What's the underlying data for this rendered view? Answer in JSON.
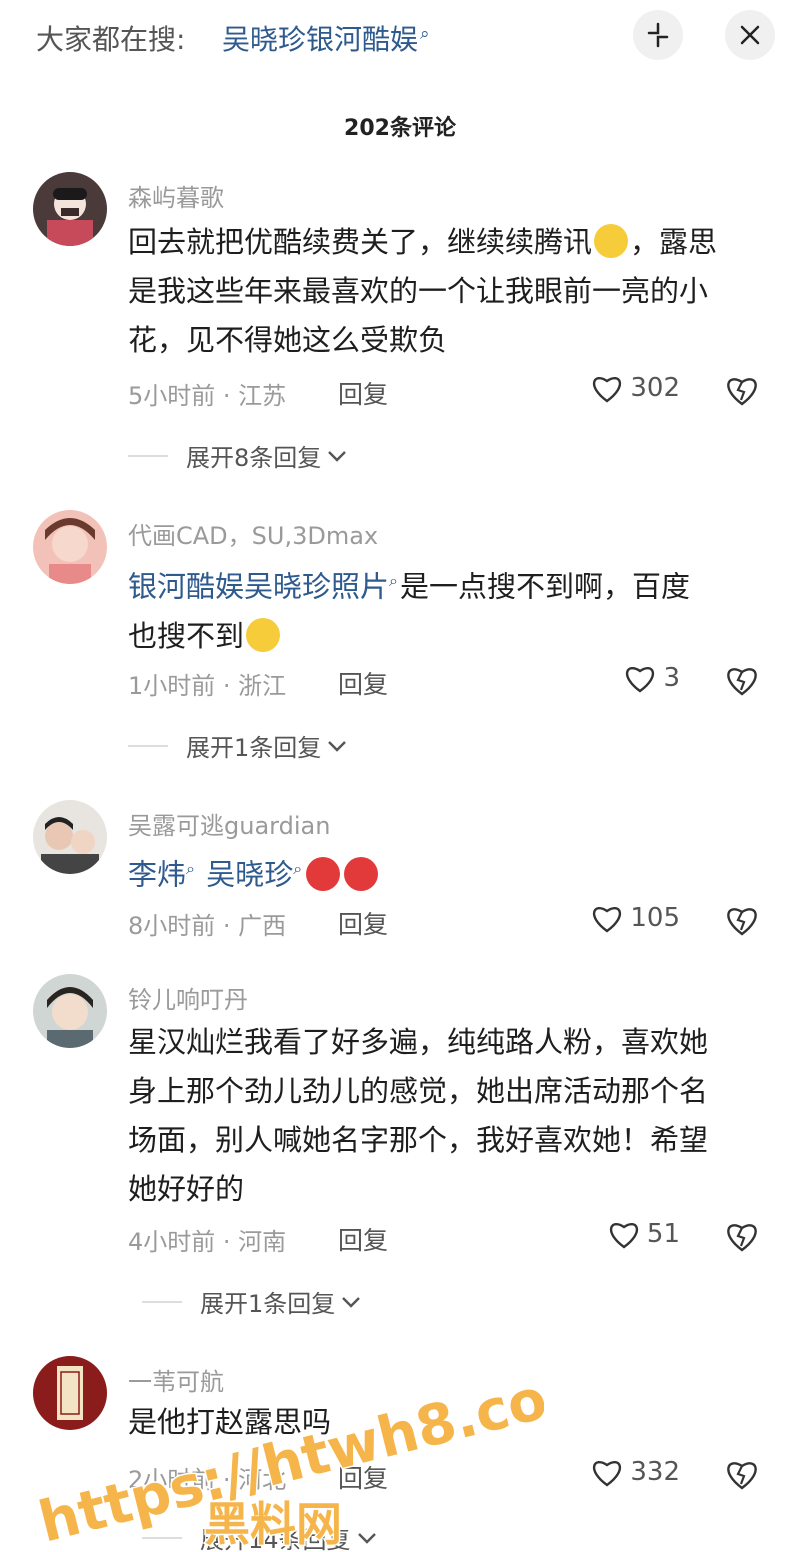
{
  "top_bar": {
    "search_prefix": "大家都在搜:",
    "search_term": "吴晓珍银河酷娱",
    "collapse_icon": "collapse-icon",
    "close_icon": "close-icon"
  },
  "comment_count": "202条评论",
  "comments": [
    {
      "username": "森屿暮歌",
      "text_lines": [
        "回去就把优酷续费关了，继续续腾讯",
        "，露思",
        "是我这些年来最喜欢的一个让我眼前一亮的小",
        "花，见不得她这么受欺负"
      ],
      "time_location": "5小时前 · 江苏",
      "reply_label": "回复",
      "likes": "302",
      "expand_label": "展开8条回复"
    },
    {
      "username": "代画CAD，SU,3Dmax",
      "link_text": "银河酷娱吴晓珍照片",
      "text_after_link": "是一点搜不到啊，百度",
      "text_line2": "也搜不到",
      "time_location": "1小时前 · 浙江",
      "reply_label": "回复",
      "likes": "3",
      "expand_label": "展开1条回复"
    },
    {
      "username": "吴露可逃guardian",
      "link1": "李炜",
      "link2": "吴晓珍",
      "time_location": "8小时前 · 广西",
      "reply_label": "回复",
      "likes": "105"
    },
    {
      "username": "铃儿响叮丹",
      "text_lines": [
        "星汉灿烂我看了好多遍，纯纯路人粉，喜欢她",
        "身上那个劲儿劲儿的感觉，她出席活动那个名",
        "场面，别人喊她名字那个，我好喜欢她！希望",
        "她好好的"
      ],
      "time_location": "4小时前 · 河南",
      "reply_label": "回复",
      "likes": "51",
      "expand_label": "展开1条回复"
    },
    {
      "username": "一苇可航",
      "text": "是他打赵露思吗",
      "time_location": "2小时前 · 河北",
      "reply_label": "回复",
      "likes": "332",
      "expand_label": "展开14条回复"
    }
  ],
  "watermark": {
    "url": "https://htwh8.com",
    "site_name": "黑料网"
  }
}
